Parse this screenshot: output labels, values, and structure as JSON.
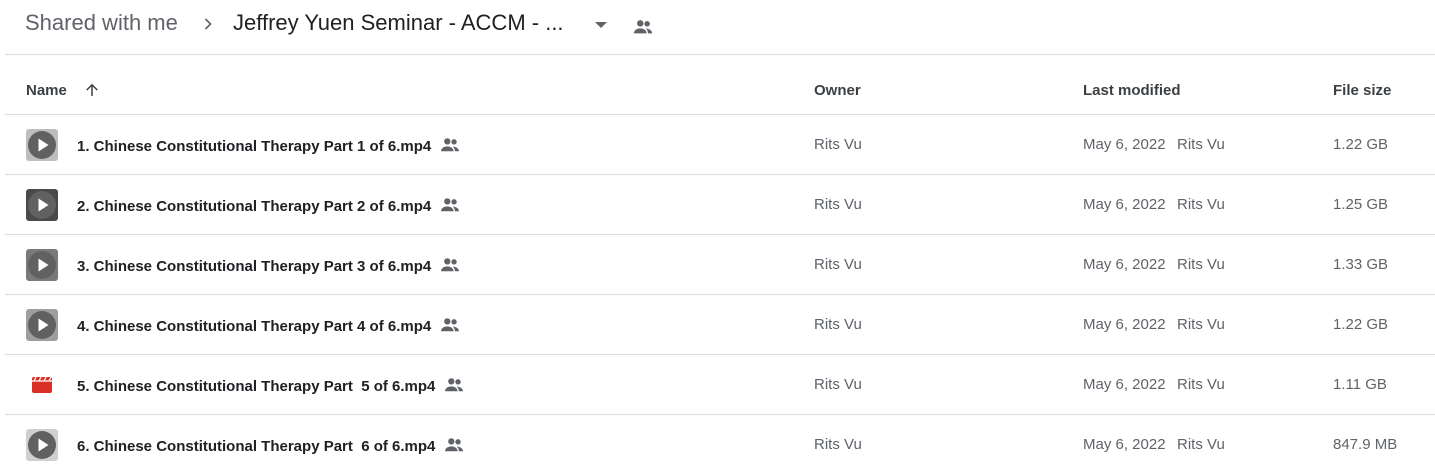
{
  "breadcrumb": {
    "root": "Shared with me",
    "current": "Jeffrey Yuen Seminar - ACCM - ...",
    "separator_icon": "chevron-right-icon",
    "dropdown_icon": "arrow-drop-down-icon",
    "shared_icon": "people-icon"
  },
  "table": {
    "columns": {
      "name": "Name",
      "owner": "Owner",
      "last_modified": "Last modified",
      "file_size": "File size"
    },
    "sort_icon": "arrow-up-icon",
    "rows": [
      {
        "icon": "video-thumbnail-play-icon",
        "name": "1. Chinese Constitutional Therapy Part 1 of 6.mp4",
        "owner": "Rits Vu",
        "modified_date": "May 6, 2022",
        "modified_by": "Rits Vu",
        "size": "1.22 GB"
      },
      {
        "icon": "video-thumbnail-play-icon",
        "name": "2. Chinese Constitutional Therapy Part 2 of 6.mp4",
        "owner": "Rits Vu",
        "modified_date": "May 6, 2022",
        "modified_by": "Rits Vu",
        "size": "1.25 GB"
      },
      {
        "icon": "video-thumbnail-play-icon",
        "name": "3. Chinese Constitutional Therapy Part 3 of 6.mp4",
        "owner": "Rits Vu",
        "modified_date": "May 6, 2022",
        "modified_by": "Rits Vu",
        "size": "1.33 GB"
      },
      {
        "icon": "video-thumbnail-play-icon",
        "name": "4. Chinese Constitutional Therapy Part 4 of 6.mp4",
        "owner": "Rits Vu",
        "modified_date": "May 6, 2022",
        "modified_by": "Rits Vu",
        "size": "1.22 GB"
      },
      {
        "icon": "video-file-icon",
        "name": "5. Chinese Constitutional Therapy Part  5 of 6.mp4",
        "owner": "Rits Vu",
        "modified_date": "May 6, 2022",
        "modified_by": "Rits Vu",
        "size": "1.11 GB"
      },
      {
        "icon": "video-thumbnail-play-icon",
        "name": "6. Chinese Constitutional Therapy Part  6 of 6.mp4",
        "owner": "Rits Vu",
        "modified_date": "May 6, 2022",
        "modified_by": "Rits Vu",
        "size": "847.9 MB"
      }
    ]
  },
  "colors": {
    "text_primary": "#202124",
    "text_secondary": "#5f6368",
    "divider": "#dadce0",
    "video_red": "#d93025",
    "thumb_dark": "#616161"
  }
}
